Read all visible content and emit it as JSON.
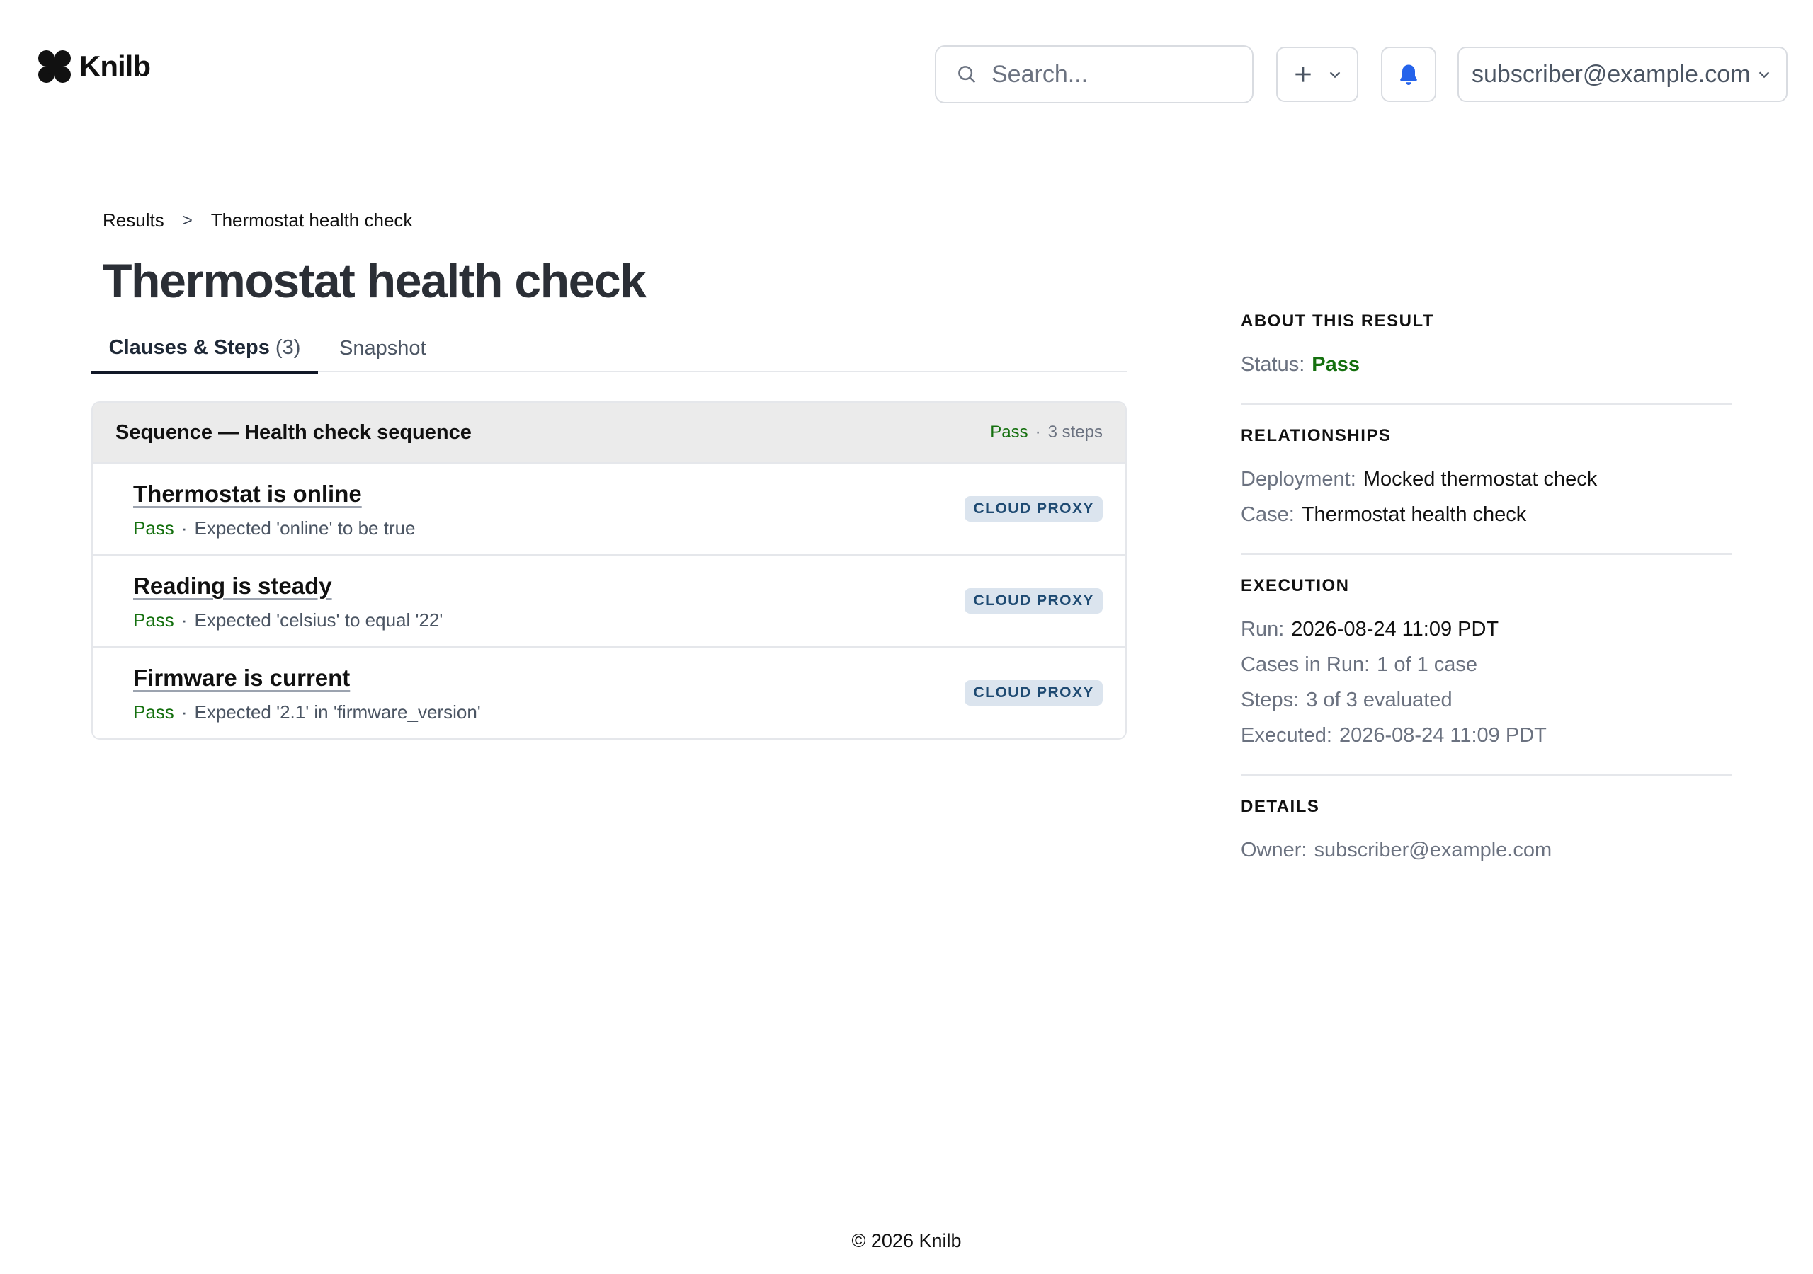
{
  "brand": {
    "name": "Knilb"
  },
  "header": {
    "search_placeholder": "Search...",
    "user_email": "subscriber@example.com"
  },
  "breadcrumb": {
    "root": "Results",
    "separator": ">",
    "current": "Thermostat health check"
  },
  "page": {
    "title": "Thermostat health check"
  },
  "tabs": [
    {
      "label": "Clauses & Steps",
      "count": "(3)",
      "active": true
    },
    {
      "label": "Snapshot",
      "active": false
    }
  ],
  "sequence": {
    "title": "Sequence — Health check sequence",
    "status": "Pass",
    "dot": "·",
    "step_count": "3 steps",
    "steps": [
      {
        "name": "Thermostat is online",
        "status": "Pass",
        "detail": "Expected 'online' to be true",
        "badge": "CLOUD PROXY"
      },
      {
        "name": "Reading is steady",
        "status": "Pass",
        "detail": "Expected 'celsius' to equal '22'",
        "badge": "CLOUD PROXY"
      },
      {
        "name": "Firmware is current",
        "status": "Pass",
        "detail": "Expected '2.1' in 'firmware_version'",
        "badge": "CLOUD PROXY"
      }
    ]
  },
  "sidebar": {
    "about": {
      "heading": "ABOUT THIS RESULT",
      "status_label": "Status:",
      "status_value": "Pass"
    },
    "relationships": {
      "heading": "RELATIONSHIPS",
      "deployment_label": "Deployment:",
      "deployment_value": "Mocked thermostat check",
      "case_label": "Case:",
      "case_value": "Thermostat health check"
    },
    "execution": {
      "heading": "EXECUTION",
      "run_label": "Run:",
      "run_value": "2026-08-24 11:09 PDT",
      "cases_label": "Cases in Run:",
      "cases_value": "1 of 1 case",
      "steps_label": "Steps:",
      "steps_value": "3 of 3 evaluated",
      "executed_label": "Executed:",
      "executed_value": "2026-08-24 11:09 PDT"
    },
    "details": {
      "heading": "DETAILS",
      "owner_label": "Owner:",
      "owner_value": "subscriber@example.com"
    }
  },
  "footer": {
    "text": "© 2026 Knilb"
  },
  "colors": {
    "pass": "#15700f",
    "bell": "#2563eb",
    "badge_bg": "#dbe4ee",
    "badge_fg": "#1e4a72"
  }
}
